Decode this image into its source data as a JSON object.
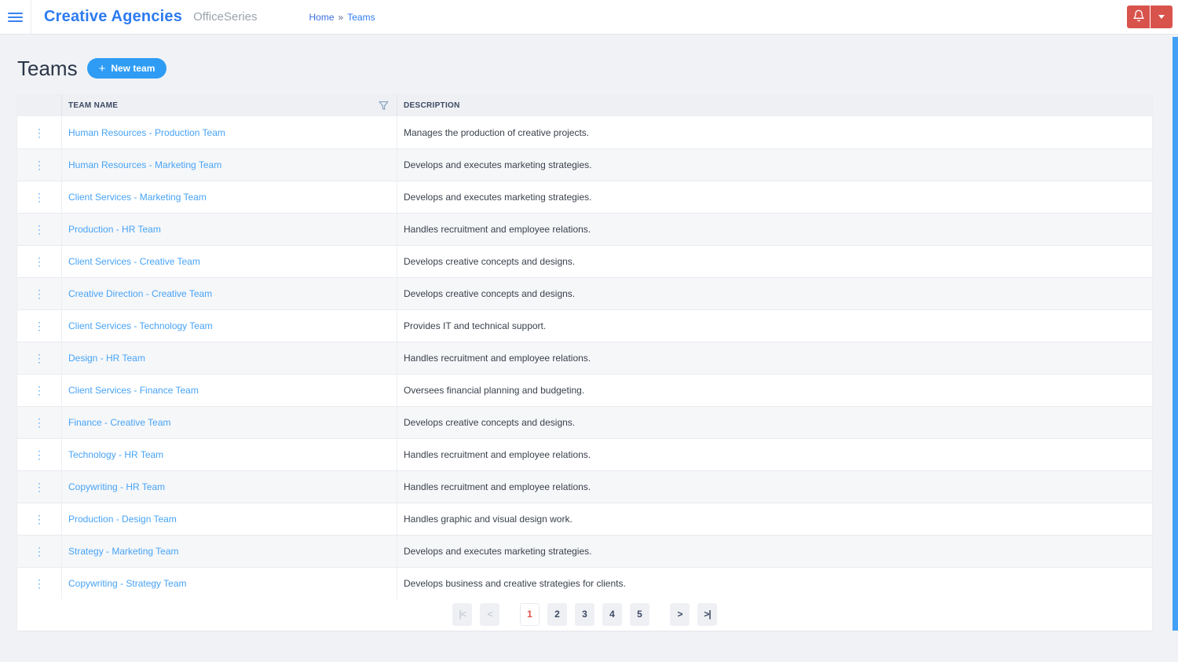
{
  "header": {
    "brand": "Creative Agencies",
    "product": "OfficeSeries",
    "breadcrumb": {
      "home": "Home",
      "separator": "»",
      "current": "Teams"
    }
  },
  "page": {
    "title": "Teams",
    "new_team_plus": "+",
    "new_team_label": "New team"
  },
  "table": {
    "columns": {
      "team_name": "TEAM NAME",
      "description": "DESCRIPTION"
    },
    "kebab_glyph": "⋮",
    "rows": [
      {
        "name": "Human Resources - Production Team",
        "description": "Manages the production of creative projects."
      },
      {
        "name": "Human Resources - Marketing Team",
        "description": "Develops and executes marketing strategies."
      },
      {
        "name": "Client Services - Marketing Team",
        "description": "Develops and executes marketing strategies."
      },
      {
        "name": "Production - HR Team",
        "description": "Handles recruitment and employee relations."
      },
      {
        "name": "Client Services - Creative Team",
        "description": "Develops creative concepts and designs."
      },
      {
        "name": "Creative Direction - Creative Team",
        "description": "Develops creative concepts and designs."
      },
      {
        "name": "Client Services - Technology Team",
        "description": "Provides IT and technical support."
      },
      {
        "name": "Design - HR Team",
        "description": "Handles recruitment and employee relations."
      },
      {
        "name": "Client Services - Finance Team",
        "description": "Oversees financial planning and budgeting."
      },
      {
        "name": "Finance - Creative Team",
        "description": "Develops creative concepts and designs."
      },
      {
        "name": "Technology - HR Team",
        "description": "Handles recruitment and employee relations."
      },
      {
        "name": "Copywriting - HR Team",
        "description": "Handles recruitment and employee relations."
      },
      {
        "name": "Production - Design Team",
        "description": "Handles graphic and visual design work."
      },
      {
        "name": "Strategy - Marketing Team",
        "description": "Develops and executes marketing strategies."
      },
      {
        "name": "Copywriting - Strategy Team",
        "description": "Develops business and creative strategies for clients."
      }
    ]
  },
  "pagination": {
    "first": "|<",
    "prev": "<",
    "pages": [
      "1",
      "2",
      "3",
      "4",
      "5"
    ],
    "current": "1",
    "next": ">",
    "last": ">|"
  },
  "colors": {
    "brand_blue": "#2d7bf0",
    "link_blue": "#47a3f5",
    "button_blue": "#2e9cf4",
    "danger_red": "#d9534d",
    "current_page_red": "#e0524a",
    "scrollbar_blue": "#42a1f7",
    "page_background": "#f0f2f5",
    "table_header_background": "#eef0f4",
    "even_row_background": "#f6f7f9"
  }
}
